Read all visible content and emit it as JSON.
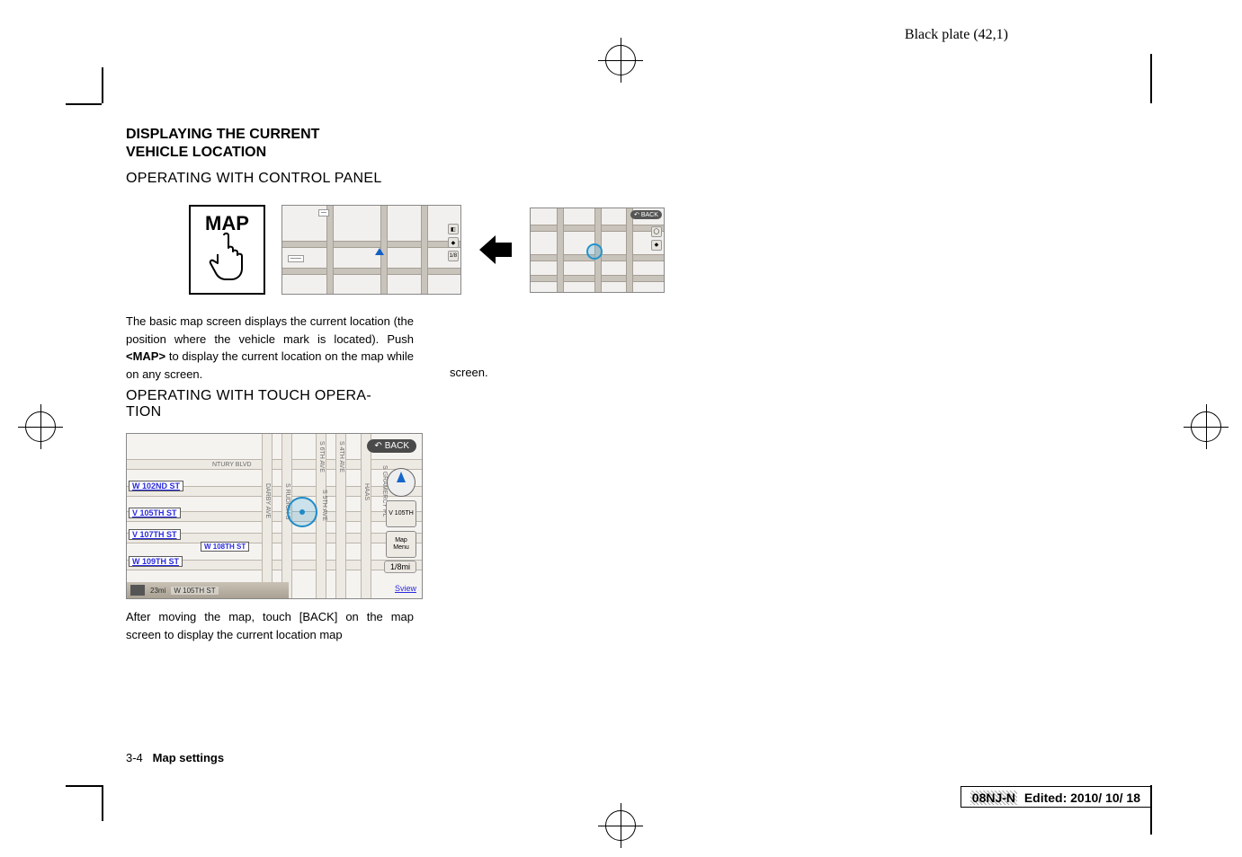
{
  "top_right": "Black plate (42,1)",
  "heading": {
    "line1": "DISPLAYING THE CURRENT",
    "line2": "VEHICLE LOCATION"
  },
  "sub1": "OPERATING WITH CONTROL PANEL",
  "map_button_label": "MAP",
  "fig1_back": "BACK",
  "fig1_zoom": "1/8",
  "paragraph1": "The basic map screen displays the current location (the position where the vehicle mark is located). Push <MAP> to display the current location on the map while on any screen.",
  "map_keyword": "<MAP>",
  "sub2_line1": "OPERATING WITH TOUCH OPERA-",
  "sub2_line2": "TION",
  "second_map": {
    "back": "BACK",
    "streets_left": [
      "W 102ND ST",
      "V 105TH ST",
      "V 107TH ST",
      "W 109TH ST"
    ],
    "street_mid": "W 108TH ST",
    "top_street": "NTURY BLVD",
    "right_stack_label1a": "V 105TH",
    "right_stack_label2a": "Map",
    "right_stack_label2b": "Menu",
    "dist": "1/8mi",
    "sview": "Sview",
    "bottom_dist": "23mi",
    "bottom_street": "W 105TH ST",
    "v_labels": [
      "S 6TH AVE",
      "S 4TH AVE"
    ],
    "v_labels2": [
      "DARBY AVE",
      "S RUDICH S"
    ],
    "haas": "HAAS",
    "gramercy": "S GRAMERCY PL",
    "s5th": "S 5TH AVE"
  },
  "paragraph2": "After moving the map, touch [BACK] on the map screen to display the current location map",
  "col2_word": "screen.",
  "footer_page": "3-4",
  "footer_title": "Map settings",
  "print_id_prefix": "08NJ-N",
  "print_id_rest": "Edited: 2010/ 10/ 18"
}
